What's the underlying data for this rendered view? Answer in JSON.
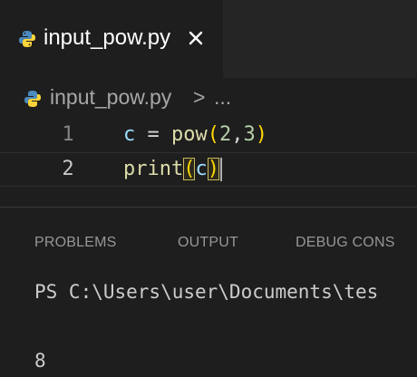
{
  "tab": {
    "title": "input_pow.py",
    "close_glyph": "✕",
    "icon": "python-file-icon"
  },
  "breadcrumb": {
    "file": "input_pow.py",
    "separator": ">",
    "more": "..."
  },
  "editor": {
    "lines": [
      {
        "number": "1",
        "text": "c = pow(2,3)"
      },
      {
        "number": "2",
        "text": "print(c)"
      }
    ],
    "tokens": {
      "l1_var": "c",
      "l1_eq": " = ",
      "l1_fn": "pow",
      "l1_open": "(",
      "l1_a": "2",
      "l1_comma": ",",
      "l1_b": "3",
      "l1_close": ")",
      "l2_fn": "print",
      "l2_open": "(",
      "l2_var": "c",
      "l2_close": ")"
    }
  },
  "panel": {
    "tabs": [
      "PROBLEMS",
      "OUTPUT",
      "DEBUG CONS"
    ],
    "terminal": {
      "prompt": "PS C:\\Users\\user\\Documents\\tes",
      "output": "8"
    }
  },
  "colors": {
    "background": "#1e1e1e",
    "tabbar": "#252526",
    "python_blue": "#4b8bbe",
    "python_yellow": "#ffd43b",
    "bracket": "#ffd700",
    "function": "#dcdcaa",
    "variable": "#9cdcfe",
    "number": "#b5cea8"
  }
}
